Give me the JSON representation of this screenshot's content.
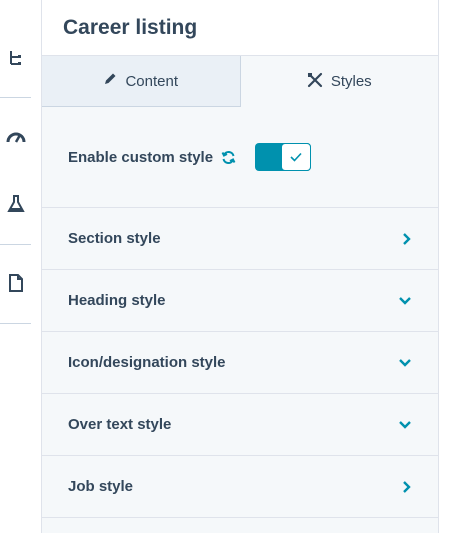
{
  "header": {
    "title": "Career listing"
  },
  "tabs": [
    {
      "label": "Content",
      "icon": "pencil-icon"
    },
    {
      "label": "Styles",
      "icon": "brush-icon"
    }
  ],
  "custom_style": {
    "label": "Enable custom style",
    "enabled": true
  },
  "sections": [
    {
      "label": "Section style",
      "chevron": "right"
    },
    {
      "label": "Heading style",
      "chevron": "down"
    },
    {
      "label": "Icon/designation style",
      "chevron": "down"
    },
    {
      "label": "Over text style",
      "chevron": "down"
    },
    {
      "label": "Job style",
      "chevron": "right"
    }
  ],
  "rail": [
    {
      "icon": "tree-icon"
    },
    {
      "icon": "gauge-icon"
    },
    {
      "icon": "flask-icon"
    },
    {
      "icon": "document-icon"
    }
  ],
  "colors": {
    "accent": "#0091ae",
    "text": "#33475b",
    "panel_bg": "#f5f8fa",
    "tab_active_bg": "#eaf0f6"
  }
}
